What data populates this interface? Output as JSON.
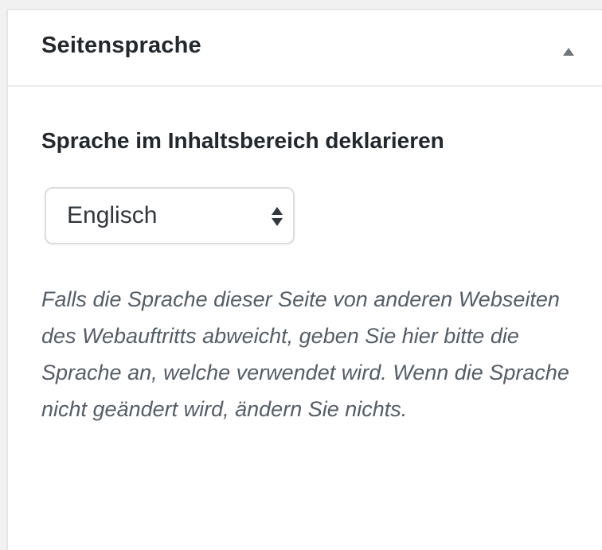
{
  "metabox": {
    "title": "Seitensprache",
    "toggle_icon": "arrow-up-icon"
  },
  "field": {
    "label": "Sprache im Inhaltsbereich deklarieren",
    "selected_value": "Englisch",
    "select_icon": "up-down-arrows-icon",
    "description": "Falls die Sprache dieser Seite von anderen Webseiten des Webauftritts abweicht, geben Sie hier bitte die Sprache an, welche verwendet wird. Wenn die Sprache nicht geändert wird, ändern Sie nichts."
  },
  "colors": {
    "title_text": "#23282d",
    "description_text": "#555d66",
    "background": "#f1f1f1",
    "panel": "#ffffff",
    "toggle_arrow": "#72777c"
  }
}
